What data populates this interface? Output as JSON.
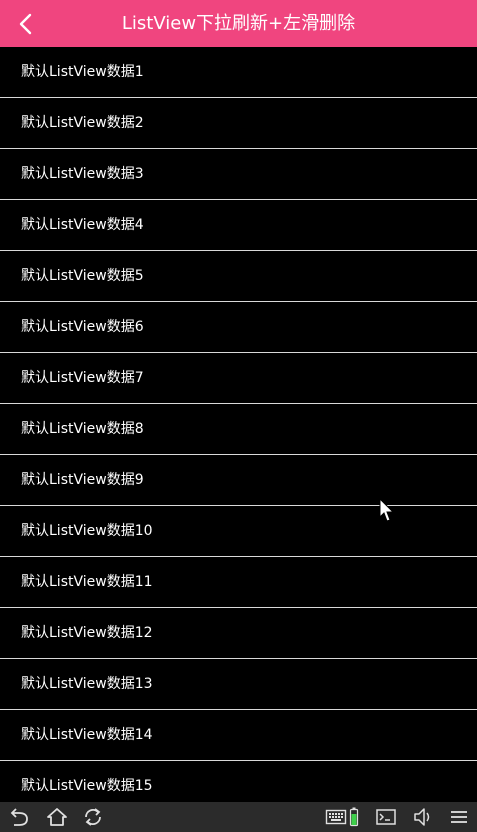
{
  "header": {
    "title": "ListView下拉刷新+左滑删除",
    "back_icon": "chevron-left-icon",
    "background": "#f0457f"
  },
  "list": {
    "items": [
      "默认ListView数据1",
      "默认ListView数据2",
      "默认ListView数据3",
      "默认ListView数据4",
      "默认ListView数据5",
      "默认ListView数据6",
      "默认ListView数据7",
      "默认ListView数据8",
      "默认ListView数据9",
      "默认ListView数据10",
      "默认ListView数据11",
      "默认ListView数据12",
      "默认ListView数据13",
      "默认ListView数据14",
      "默认ListView数据15"
    ]
  },
  "navbar": {
    "left_icons": [
      "back-icon",
      "home-icon",
      "recent-apps-icon"
    ],
    "right_icons": [
      "keyboard-icon",
      "battery-icon",
      "terminal-icon",
      "volume-icon",
      "menu-icon"
    ]
  }
}
